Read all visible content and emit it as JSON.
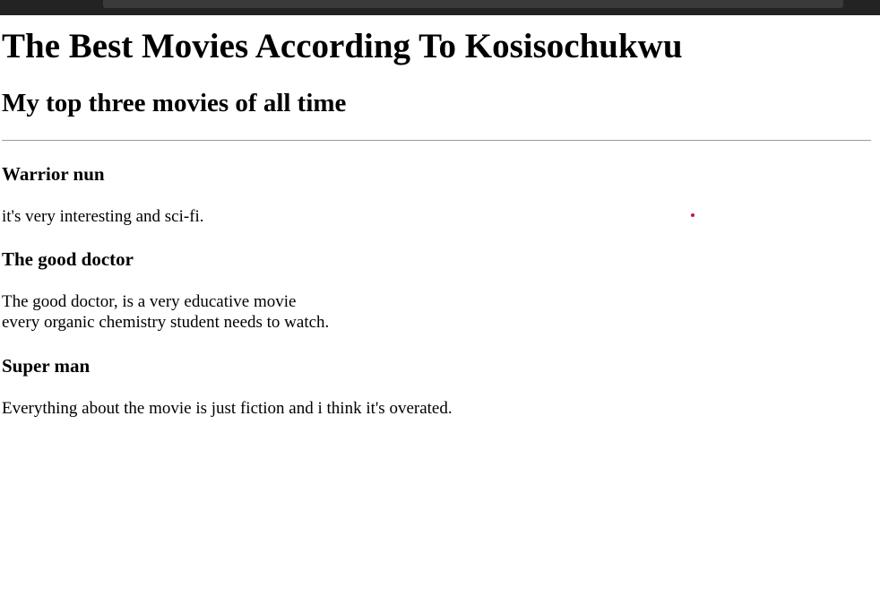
{
  "page": {
    "title": "The Best Movies According To Kosisochukwu",
    "subtitle": "My top three movies of all time"
  },
  "movies": [
    {
      "title": "Warrior nun",
      "description_lines": [
        "it's very interesting and sci-fi."
      ]
    },
    {
      "title": "The good doctor",
      "description_lines": [
        "The good doctor, is a very educative movie",
        "every organic chemistry student needs to watch."
      ]
    },
    {
      "title": "Super man",
      "description_lines": [
        "Everything about the movie is just fiction and i think it's overated."
      ]
    }
  ],
  "colors": {
    "browser_bar": "#232323",
    "address_field": "#3a3a3a",
    "divider": "#9a9a9a",
    "cursor_dot": "#d0103a"
  }
}
